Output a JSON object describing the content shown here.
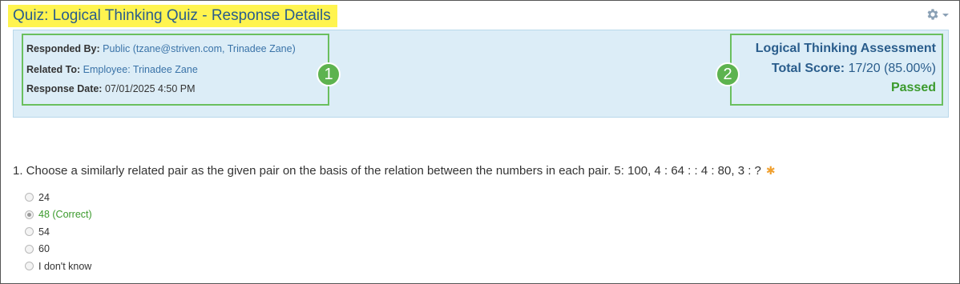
{
  "header": {
    "title": "Quiz: Logical Thinking Quiz - Response Details",
    "settings_icon": "gear-icon"
  },
  "response_info": {
    "responded_by_label": "Responded By:",
    "responded_by_value": "Public (tzane@striven.com, Trinadee Zane)",
    "related_to_label": "Related To:",
    "related_to_value": "Employee: Trinadee Zane",
    "response_date_label": "Response Date:",
    "response_date_value": "07/01/2025 4:50 PM"
  },
  "score": {
    "assessment_title": "Logical Thinking Assessment",
    "total_score_label": "Total Score:",
    "total_score_value": "17/20 (85.00%)",
    "status": "Passed"
  },
  "callouts": {
    "one": "1",
    "two": "2"
  },
  "question": {
    "text": "1. Choose a similarly related pair as the given pair on the basis of the relation between the numbers in each pair. 5: 100, 4 : 64 : : 4 : 80, 3 : ?",
    "required_mark": "✱",
    "options": [
      {
        "label": "24",
        "selected": false,
        "correct": false
      },
      {
        "label": "48 (Correct)",
        "selected": true,
        "correct": true
      },
      {
        "label": "54",
        "selected": false,
        "correct": false
      },
      {
        "label": "60",
        "selected": false,
        "correct": false
      },
      {
        "label": "I don't know",
        "selected": false,
        "correct": false
      }
    ]
  },
  "colors": {
    "title": "#2a5d8c",
    "title_highlight": "#fff44f",
    "panel_bg": "#dcedf7",
    "callout": "#6abf5e",
    "passed": "#3b9a2c",
    "link": "#3a73a8",
    "required": "#f0a030"
  }
}
